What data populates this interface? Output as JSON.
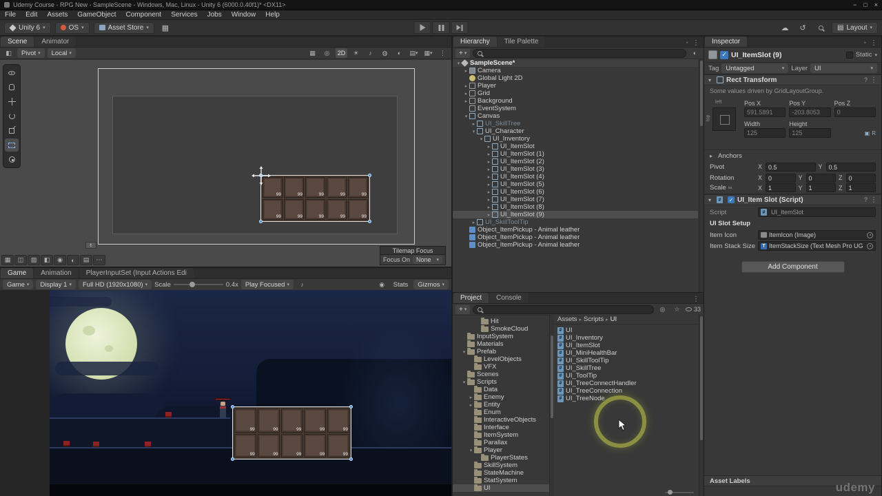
{
  "window": {
    "title": "Udemy Course - RPG New - SampleScene - Windows, Mac, Linux - Unity 6 (6000.0.40f1)* <DX11>"
  },
  "menu": [
    "File",
    "Edit",
    "Assets",
    "GameObject",
    "Component",
    "Services",
    "Jobs",
    "Window",
    "Help"
  ],
  "toolbar": {
    "unity_version": "Unity 6",
    "os": "OS",
    "asset_store": "Asset Store",
    "layout": "Layout"
  },
  "scene_panel": {
    "tabs": [
      {
        "label": "Scene",
        "active": true
      },
      {
        "label": "Animator",
        "active": false
      }
    ],
    "pivot": "Pivot",
    "local": "Local",
    "two_d": "2D",
    "tilemap_focus": {
      "title": "Tilemap Focus",
      "focus_on": "Focus On",
      "value": "None"
    },
    "tile_marker": "t"
  },
  "game_panel": {
    "tabs": [
      {
        "label": "Game",
        "active": true
      },
      {
        "label": "Animation",
        "active": false
      },
      {
        "label": "PlayerInputSet (Input Actions Edi",
        "active": false
      }
    ],
    "toolbar": {
      "mode": "Game",
      "display": "Display 1",
      "resolution": "Full HD (1920x1080)",
      "scale_label": "Scale",
      "scale_value": "0.4x",
      "play_focused": "Play Focused",
      "stats": "Stats",
      "gizmos": "Gizmos"
    }
  },
  "inventory": {
    "slots": [
      "99",
      "99",
      "99",
      "99",
      "99",
      "99",
      "99",
      "99",
      "99",
      "99"
    ]
  },
  "hierarchy": {
    "tabs": [
      {
        "label": "Hierarchy",
        "active": true
      },
      {
        "label": "Tile Palette",
        "active": false
      }
    ],
    "items": [
      {
        "depth": 0,
        "arrow": "▾",
        "icon": "scene",
        "label": "SampleScene*",
        "state": "root"
      },
      {
        "depth": 1,
        "arrow": "▸",
        "icon": "camera",
        "label": "Camera"
      },
      {
        "depth": 1,
        "arrow": "",
        "icon": "light",
        "label": "Global Light 2D"
      },
      {
        "depth": 1,
        "arrow": "▸",
        "icon": "go",
        "label": "Player"
      },
      {
        "depth": 1,
        "arrow": "▸",
        "icon": "go",
        "label": "Grid"
      },
      {
        "depth": 1,
        "arrow": "▸",
        "icon": "go",
        "label": "Background"
      },
      {
        "depth": 1,
        "arrow": "",
        "icon": "go",
        "label": "EventSystem"
      },
      {
        "depth": 1,
        "arrow": "▾",
        "icon": "ui",
        "label": "Canvas"
      },
      {
        "depth": 2,
        "arrow": "▸",
        "icon": "ui",
        "label": "UI_SkillTree",
        "state": "dim"
      },
      {
        "depth": 2,
        "arrow": "▾",
        "icon": "ui",
        "label": "UI_Character"
      },
      {
        "depth": 3,
        "arrow": "▾",
        "icon": "ui",
        "label": "UI_Inventory"
      },
      {
        "depth": 4,
        "arrow": "▸",
        "icon": "ui",
        "label": "UI_ItemSlot"
      },
      {
        "depth": 4,
        "arrow": "▸",
        "icon": "ui",
        "label": "UI_ItemSlot (1)"
      },
      {
        "depth": 4,
        "arrow": "▸",
        "icon": "ui",
        "label": "UI_ItemSlot (2)"
      },
      {
        "depth": 4,
        "arrow": "▸",
        "icon": "ui",
        "label": "UI_ItemSlot (3)"
      },
      {
        "depth": 4,
        "arrow": "▸",
        "icon": "ui",
        "label": "UI_ItemSlot (4)"
      },
      {
        "depth": 4,
        "arrow": "▸",
        "icon": "ui",
        "label": "UI_ItemSlot (5)"
      },
      {
        "depth": 4,
        "arrow": "▸",
        "icon": "ui",
        "label": "UI_ItemSlot (6)"
      },
      {
        "depth": 4,
        "arrow": "▸",
        "icon": "ui",
        "label": "UI_ItemSlot (7)"
      },
      {
        "depth": 4,
        "arrow": "▸",
        "icon": "ui",
        "label": "UI_ItemSlot (8)"
      },
      {
        "depth": 4,
        "arrow": "▸",
        "icon": "ui",
        "label": "UI_ItemSlot (9)",
        "state": "sel"
      },
      {
        "depth": 2,
        "arrow": "▸",
        "icon": "ui",
        "label": "UI_SkillToolTip",
        "state": "dim"
      },
      {
        "depth": 1,
        "arrow": "",
        "icon": "prefab",
        "label": "Object_ItemPickup - Animal leather"
      },
      {
        "depth": 1,
        "arrow": "",
        "icon": "prefab",
        "label": "Object_ItemPickup - Animal leather"
      },
      {
        "depth": 1,
        "arrow": "",
        "icon": "prefab",
        "label": "Object_ItemPickup - Animal leather"
      }
    ]
  },
  "project": {
    "tabs": [
      {
        "label": "Project",
        "active": true
      },
      {
        "label": "Console",
        "active": false
      }
    ],
    "breadcrumb": [
      "Assets",
      "Scripts",
      "UI"
    ],
    "hidden_count": "33",
    "folders": [
      {
        "depth": 3,
        "arrow": "",
        "label": "Hit"
      },
      {
        "depth": 3,
        "arrow": "",
        "label": "SmokeCloud"
      },
      {
        "depth": 1,
        "arrow": "",
        "label": "InputSystem"
      },
      {
        "depth": 1,
        "arrow": "",
        "label": "Materials"
      },
      {
        "depth": 1,
        "arrow": "▾",
        "label": "Prefab"
      },
      {
        "depth": 2,
        "arrow": "",
        "label": "LevelObjects"
      },
      {
        "depth": 2,
        "arrow": "",
        "label": "VFX"
      },
      {
        "depth": 1,
        "arrow": "",
        "label": "Scenes"
      },
      {
        "depth": 1,
        "arrow": "▾",
        "label": "Scripts"
      },
      {
        "depth": 2,
        "arrow": "",
        "label": "Data"
      },
      {
        "depth": 2,
        "arrow": "▸",
        "label": "Enemy"
      },
      {
        "depth": 2,
        "arrow": "▸",
        "label": "Entity"
      },
      {
        "depth": 2,
        "arrow": "",
        "label": "Enum"
      },
      {
        "depth": 2,
        "arrow": "",
        "label": "InteractiveObjects"
      },
      {
        "depth": 2,
        "arrow": "",
        "label": "Interface"
      },
      {
        "depth": 2,
        "arrow": "",
        "label": "ItemSystem"
      },
      {
        "depth": 2,
        "arrow": "",
        "label": "Parallax"
      },
      {
        "depth": 2,
        "arrow": "▾",
        "label": "Player"
      },
      {
        "depth": 3,
        "arrow": "",
        "label": "PlayerStates"
      },
      {
        "depth": 2,
        "arrow": "",
        "label": "SkillSystem"
      },
      {
        "depth": 2,
        "arrow": "",
        "label": "StateMachine"
      },
      {
        "depth": 2,
        "arrow": "",
        "label": "StatSystem"
      },
      {
        "depth": 2,
        "arrow": "",
        "label": "UI",
        "state": "sel"
      }
    ],
    "files": [
      "UI",
      "UI_Inventory",
      "UI_ItemSlot",
      "UI_MiniHealthBar",
      "UI_SkillToolTip",
      "UI_SkillTree",
      "UI_ToolTip",
      "UI_TreeConnectHandler",
      "UI_TreeConnection",
      "UI_TreeNode"
    ]
  },
  "inspector": {
    "tabs": [
      {
        "label": "Inspector",
        "active": true
      }
    ],
    "header": {
      "name": "UI_ItemSlot (9)",
      "static_label": "Static"
    },
    "tag_row": {
      "tag_label": "Tag",
      "tag": "Untagged",
      "layer_label": "Layer",
      "layer": "UI"
    },
    "rect_transform": {
      "title": "Rect Transform",
      "note": "Some values driven by GridLayoutGroup.",
      "anchor_left": "left",
      "anchor_top": "top",
      "pos": [
        {
          "label": "Pos X",
          "value": "591.5891"
        },
        {
          "label": "Pos Y",
          "value": "-203.8053"
        },
        {
          "label": "Pos Z",
          "value": "0"
        }
      ],
      "size": [
        {
          "label": "Width",
          "value": "125"
        },
        {
          "label": "Height",
          "value": "125"
        }
      ],
      "anchors_label": "Anchors",
      "pivot_label": "Pivot",
      "pivot": [
        {
          "label": "X",
          "value": "0.5"
        },
        {
          "label": "Y",
          "value": "0.5"
        }
      ],
      "rotation_label": "Rotation",
      "rotation": [
        {
          "label": "X",
          "value": "0"
        },
        {
          "label": "Y",
          "value": "0"
        },
        {
          "label": "Z",
          "value": "0"
        }
      ],
      "scale_label": "Scale",
      "scale": [
        {
          "label": "X",
          "value": "1"
        },
        {
          "label": "Y",
          "value": "1"
        },
        {
          "label": "Z",
          "value": "1"
        }
      ]
    },
    "script_component": {
      "title": "UI_Item Slot (Script)",
      "script_label": "Script",
      "script_value": "UI_ItemSlot",
      "section": "UI Slot Setup",
      "item_icon_label": "Item Icon",
      "item_icon_value": "ItemIcon (Image)",
      "stack_label": "Item Stack Size",
      "stack_value": "ItemStackSize (Text Mesh Pro UG"
    },
    "add_component": "Add Component",
    "asset_labels": "Asset Labels"
  },
  "watermark": "udemy"
}
